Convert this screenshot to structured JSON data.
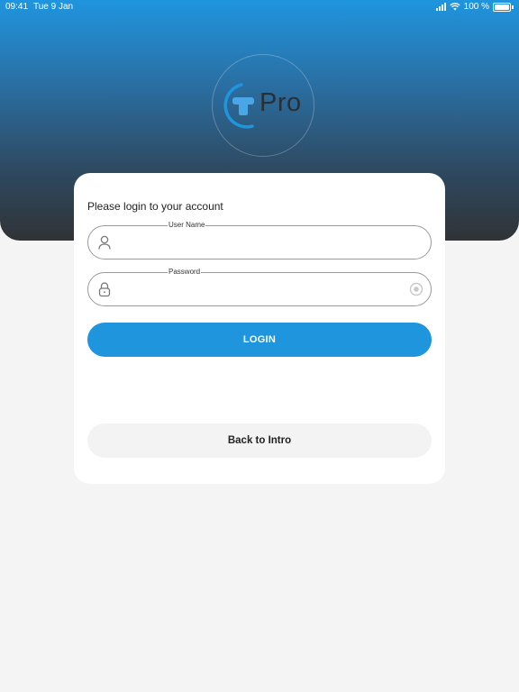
{
  "status_bar": {
    "time": "09:41",
    "date": "Tue 9 Jan",
    "battery": "100 %"
  },
  "logo": {
    "text": "Pro",
    "accent_color": "#1f95de"
  },
  "login_card": {
    "title": "Please login to your account",
    "username": {
      "label": "User Name",
      "value": "",
      "icon": "user-icon"
    },
    "password": {
      "label": "Password",
      "value": "",
      "icon": "lock-icon",
      "toggle_icon": "eye-icon"
    },
    "login_button": "LOGIN",
    "back_button": "Back to Intro"
  },
  "colors": {
    "primary": "#1f95de",
    "background": "#f4f4f4",
    "header_dark": "#303336"
  }
}
